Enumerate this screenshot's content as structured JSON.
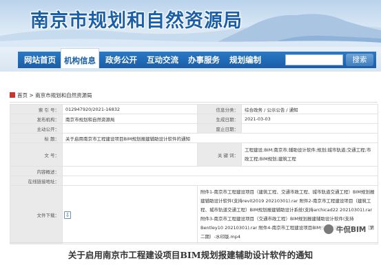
{
  "header": {
    "site_title": "南京市规划和自然资源局"
  },
  "nav": {
    "items": [
      {
        "label": "网站首页",
        "active": false
      },
      {
        "label": "机构信息",
        "active": true
      },
      {
        "label": "政务公开",
        "active": false
      },
      {
        "label": "互动交流",
        "active": false
      },
      {
        "label": "办事服务",
        "active": false
      },
      {
        "label": "规划编制",
        "active": false
      }
    ],
    "search_placeholder": "",
    "search_button": "搜索"
  },
  "breadcrumb": {
    "items": [
      "首页",
      ">",
      "南京市规划和自然资源局"
    ]
  },
  "info": {
    "labels": {
      "index_no": "索 引 号：",
      "info_category": "信息分类：",
      "publisher": "发布机构：",
      "date": "生成日期：",
      "subject": "主动公开：",
      "disclosure": "废止日期：",
      "title": "标 题：",
      "doc_no": "文 号：",
      "keywords": "关 键 词：",
      "summary": "内容概述：",
      "validity": "在线链接地址：",
      "attachments": "文件下载："
    },
    "index_no": "012947920/2021-16832",
    "info_category": "综合政务 / 公示公告 / 通知",
    "publisher": "南京市规划和自然资源局",
    "date": "2021-03-03",
    "title": "关于启用南京市工程建设项目BIM规划报建辅助设计软件的通知",
    "keywords": "工程建设;BIM;南京市;辅助设计软件;规划;城市轨道;交通工程;市政工程;BIM规划;建筑工程",
    "attachments": [
      "附件1-南京市工程建设项目（建筑工程、交通市政工程、城市轨道交通工程）BIM规划报建辅助设计软件(支持revit2019 20210301).rar",
      "附件2-南京市工程建设项目（建筑工程、城市轨道交通工程）BIM规划报建辅助设计系统(支持archicad22 20210301).rar",
      "附件3-南京市工程建设项目（交通市政工程）BIM规划报建辅助设计软件(支持Bentley10 20210301).rar",
      "附件4-南京市工程建设项目BIM规划报建试点培训视频（第二期）-水印版.mp4"
    ]
  },
  "article": {
    "title": "关于启用南京市工程建设项目BIM规划报建辅助设计软件的通知"
  },
  "watermark": {
    "text": "牛侃BIM"
  },
  "colors": {
    "nav_blue": "#1a5ea6",
    "title_blue": "#1a5fa8",
    "label_bg": "#eaeaea"
  }
}
